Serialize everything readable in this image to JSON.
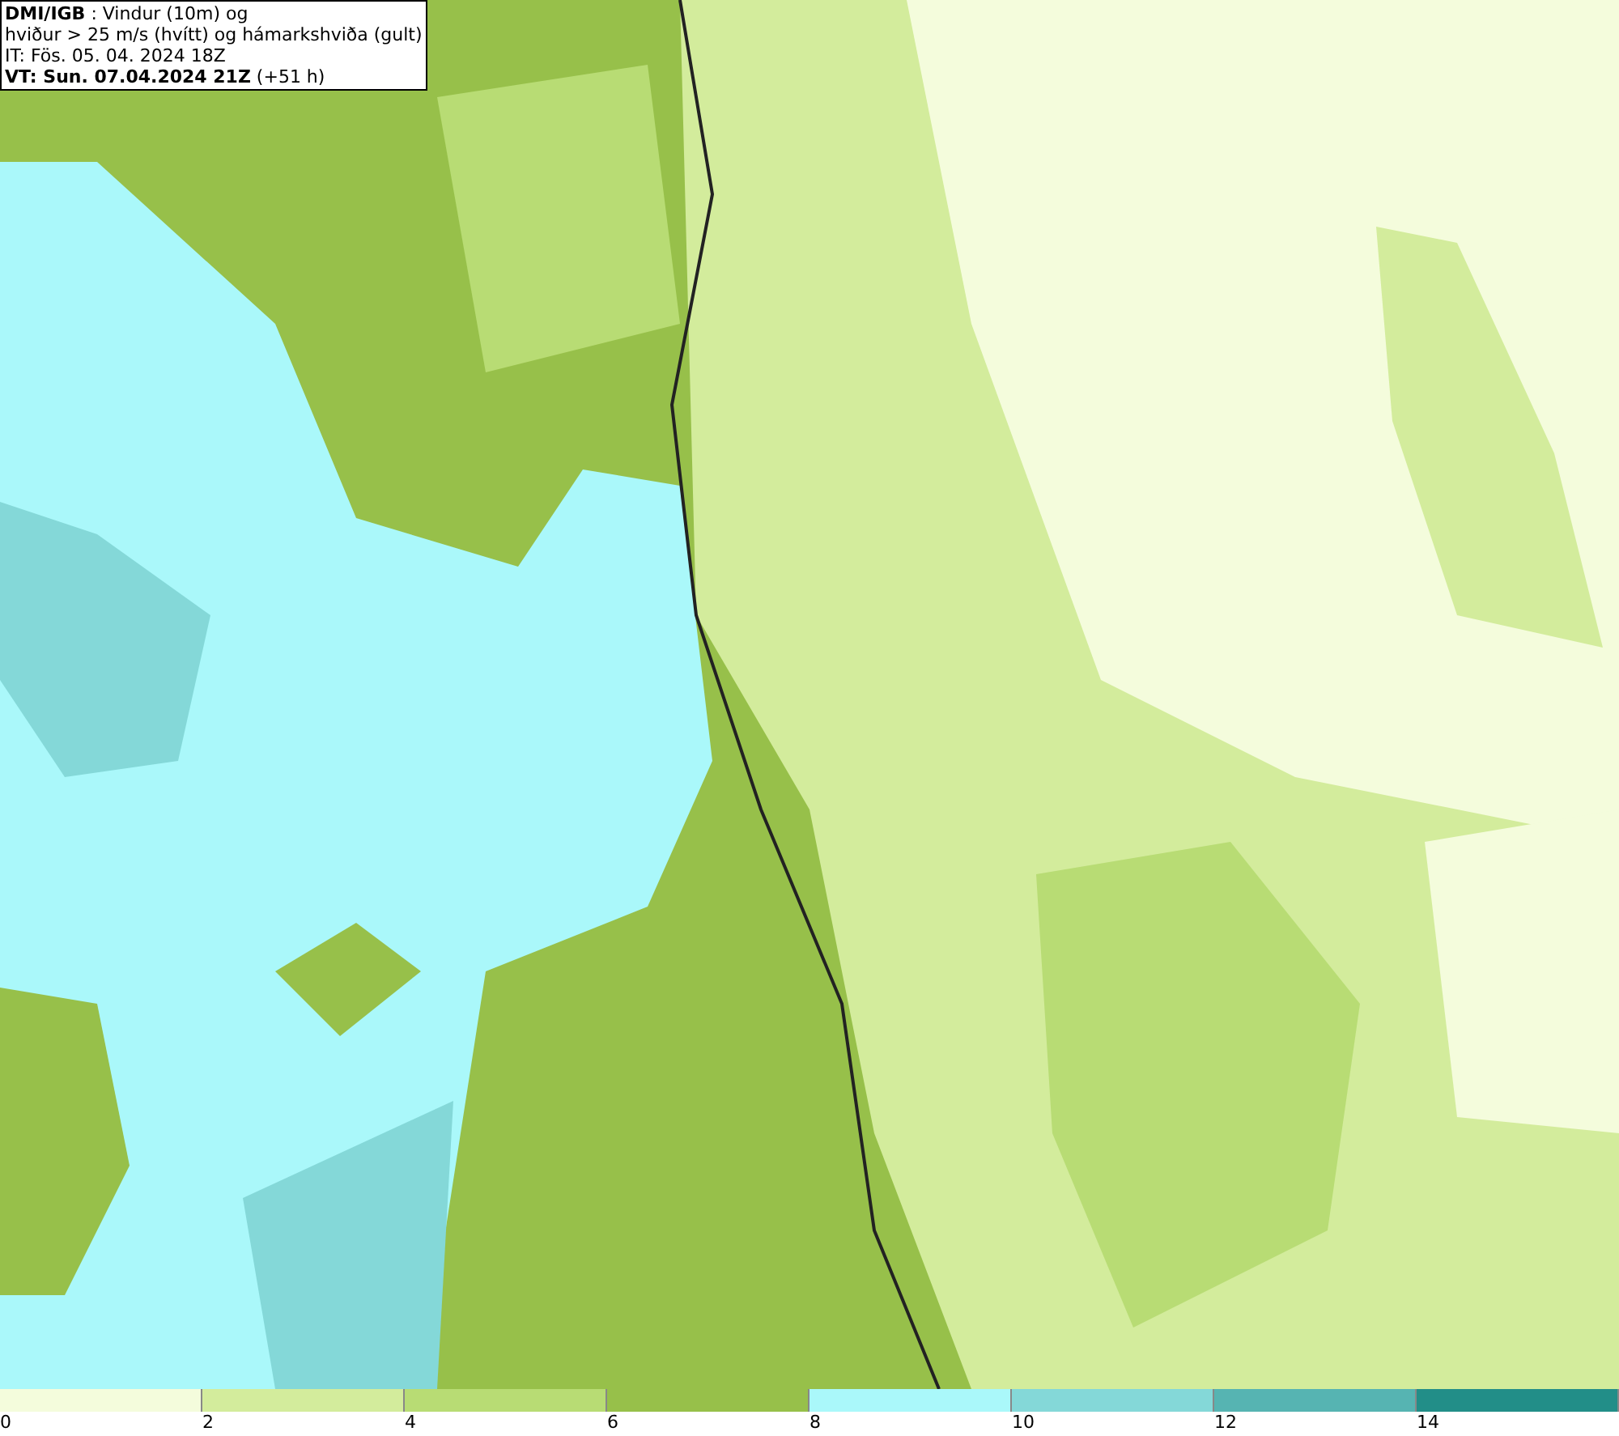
{
  "title_lines": [
    "**DMI/IGB** : Vindur (10m) og",
    "hviður > 25 m/s (hvítt) og hámarkshviða (gult)",
    "IT: Fös. 05. 04. 2024 18Z",
    "**VT: Sun. 07.04.2024 21Z** (+51 h)"
  ],
  "legend": [
    {
      "label": "0",
      "color": "#f4fcdc"
    },
    {
      "label": "2",
      "color": "#d3ec9c"
    },
    {
      "label": "4",
      "color": "#b8dc74"
    },
    {
      "label": "6",
      "color": "#97c04a"
    },
    {
      "label": "8",
      "color": "#aaf8fa"
    },
    {
      "label": "10",
      "color": "#84d8d8"
    },
    {
      "label": "12",
      "color": "#56b4b2"
    },
    {
      "label": "14",
      "color": "#228e88"
    }
  ]
}
